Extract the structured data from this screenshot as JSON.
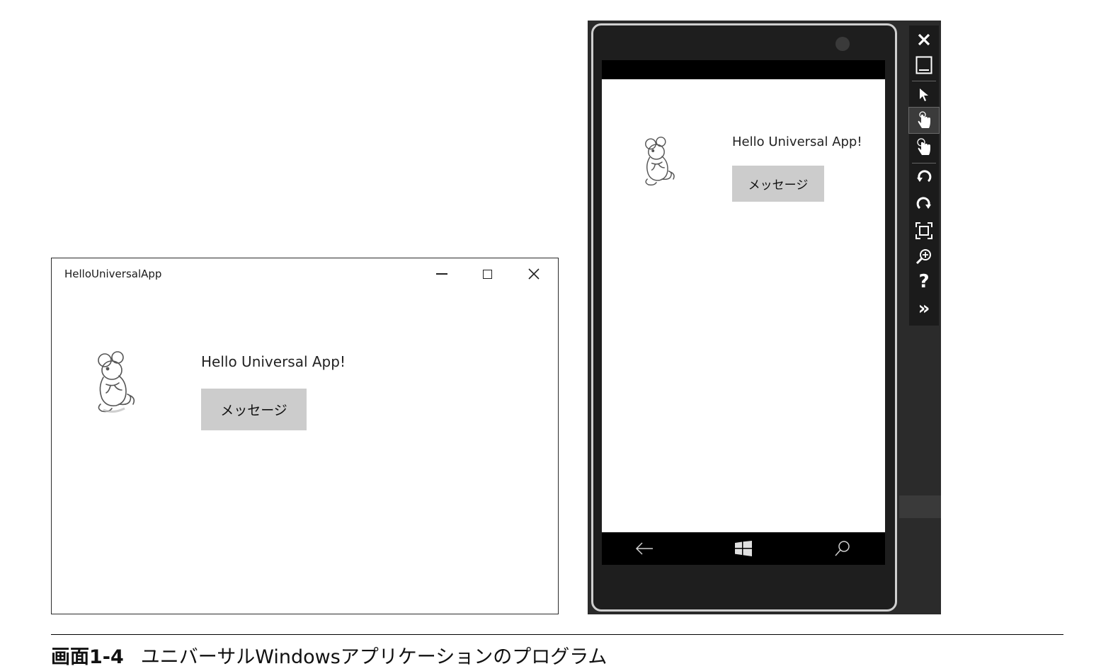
{
  "desktop_window": {
    "title": "HelloUniversalApp",
    "caption_buttons": [
      "minimize",
      "maximize",
      "close"
    ],
    "mascot_icon": "mouse-mascot-icon",
    "hello_text": "Hello Universal App!",
    "message_button_label": "メッセージ"
  },
  "phone_emulator": {
    "hello_text": "Hello Universal App!",
    "message_button_label": "メッセージ",
    "mascot_icon": "mouse-mascot-icon",
    "nav_icons": [
      "back-arrow-icon",
      "windows-start-icon",
      "search-icon"
    ],
    "toolbar": [
      {
        "icon": "close-icon",
        "glyph": "✕"
      },
      {
        "icon": "minimize-icon",
        "glyph": "▭"
      },
      {
        "icon": "mouse-pointer-icon",
        "glyph": "➤"
      },
      {
        "icon": "single-touch-icon",
        "glyph": "☝"
      },
      {
        "icon": "multi-touch-icon",
        "glyph": "☝"
      },
      {
        "icon": "rotate-left-icon",
        "glyph": "↺"
      },
      {
        "icon": "rotate-right-icon",
        "glyph": "↻"
      },
      {
        "icon": "fit-to-screen-icon",
        "glyph": "⛶"
      },
      {
        "icon": "zoom-icon",
        "glyph": "⊕"
      },
      {
        "icon": "help-icon",
        "glyph": "?"
      },
      {
        "icon": "more-tools-icon",
        "glyph": "»"
      }
    ]
  },
  "caption": {
    "number": "画面1-4",
    "title": "ユニバーサルWindowsアプリケーションのプログラム"
  },
  "colors": {
    "phone_frame": "#1e1e1e",
    "button_gray": "#cccccc",
    "bar_black": "#000000"
  }
}
